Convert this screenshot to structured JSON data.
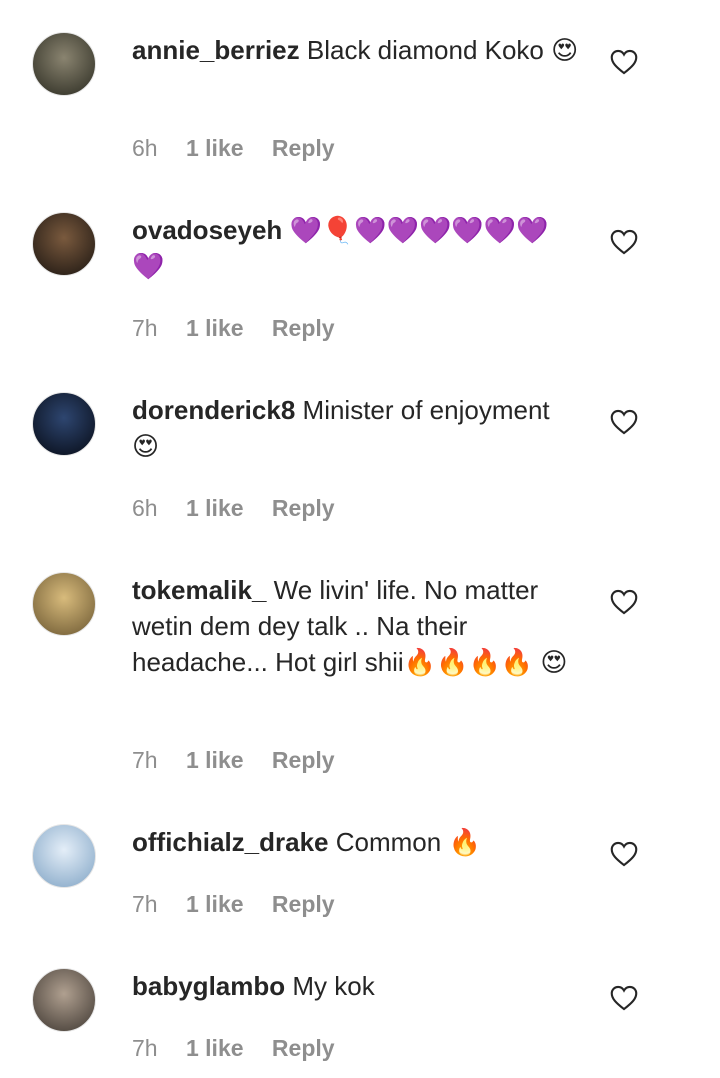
{
  "comments": [
    {
      "username": "annie_berriez",
      "text": "Black diamond Koko 😍",
      "time": "6h",
      "likes": "1 like",
      "reply": "Reply",
      "avatar_colors": [
        "#5a5648",
        "#2a2a20"
      ]
    },
    {
      "username": "ovadoseyeh",
      "text": "💜🎈💜💜💜💜💜💜 💜",
      "time": "7h",
      "likes": "1 like",
      "reply": "Reply",
      "avatar_colors": [
        "#4a2e22",
        "#1a1410"
      ]
    },
    {
      "username": "dorenderick8",
      "text": "Minister of enjoyment 😍",
      "time": "6h",
      "likes": "1 like",
      "reply": "Reply",
      "avatar_colors": [
        "#1b2d4a",
        "#060a14"
      ]
    },
    {
      "username": "tokemalik_",
      "text": "We livin' life. No matter wetin dem dey talk .. Na their headache... Hot girl shii🔥🔥🔥🔥 😍",
      "time": "7h",
      "likes": "1 like",
      "reply": "Reply",
      "avatar_colors": [
        "#b79a5c",
        "#6a5630"
      ]
    },
    {
      "username": "offichialz_drake",
      "text": "Common 🔥",
      "time": "7h",
      "likes": "1 like",
      "reply": "Reply",
      "avatar_colors": [
        "#c6d6e6",
        "#7fa3c4"
      ]
    },
    {
      "username": "babyglambo",
      "text": "My kok",
      "time": "7h",
      "likes": "1 like",
      "reply": "Reply",
      "avatar_colors": [
        "#8a7c70",
        "#3d3630"
      ]
    }
  ]
}
